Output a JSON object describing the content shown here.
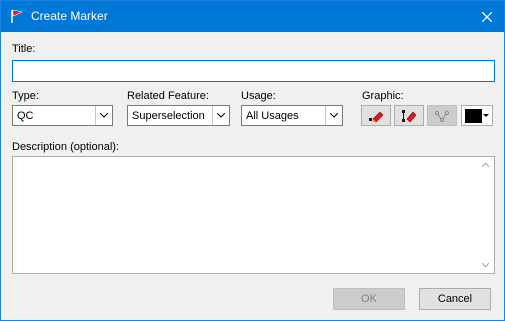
{
  "window": {
    "title": "Create Marker",
    "accent_color": "#0078d7",
    "icon": "red-flag-icon",
    "close_icon": "close-icon"
  },
  "form": {
    "title_label": "Title:",
    "title_value": "",
    "type_label": "Type:",
    "type_value": "QC",
    "related_label": "Related Feature:",
    "related_value": "Superselection",
    "usage_label": "Usage:",
    "usage_value": "All Usages",
    "graphic_label": "Graphic:",
    "graphic_buttons": [
      "pencil-marker-icon",
      "pencil-range-icon",
      "node-link-icon"
    ],
    "color_value": "#000000",
    "description_label": "Description (optional):",
    "description_value": ""
  },
  "buttons": {
    "ok_label": "OK",
    "cancel_label": "Cancel"
  }
}
